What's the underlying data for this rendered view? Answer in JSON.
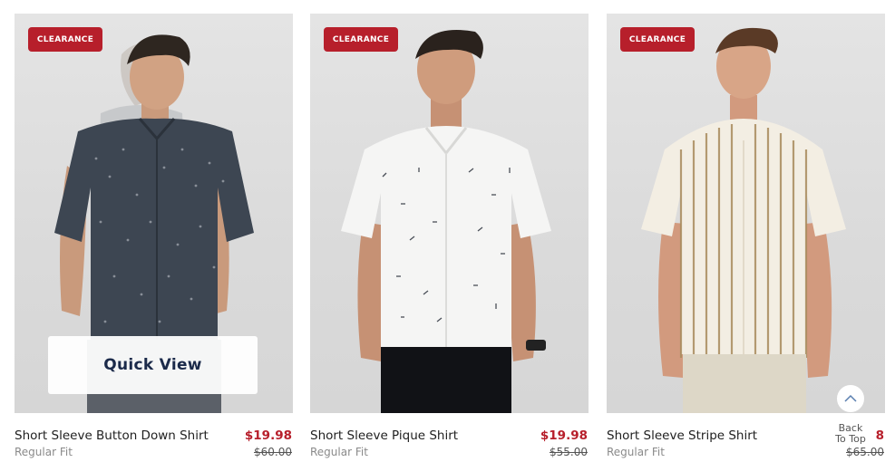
{
  "products": [
    {
      "badge": "CLEARANCE",
      "name": "Short Sleeve Button Down Shirt",
      "fit": "Regular Fit",
      "sale_price": "$19.98",
      "original_price": "$60.00",
      "quick_view": "Quick View"
    },
    {
      "badge": "CLEARANCE",
      "name": "Short Sleeve Pique Shirt",
      "fit": "Regular Fit",
      "sale_price": "$19.98",
      "original_price": "$55.00"
    },
    {
      "badge": "CLEARANCE",
      "name": "Short Sleeve Stripe Shirt",
      "fit": "Regular Fit",
      "sale_price": "8",
      "original_price": "$65.00"
    }
  ],
  "back_to_top": {
    "line1": "Back",
    "line2": "To Top"
  },
  "colors": {
    "badge": "#b71f2b",
    "sale": "#b71f2b",
    "quick_view_text": "#1b2a4a"
  }
}
